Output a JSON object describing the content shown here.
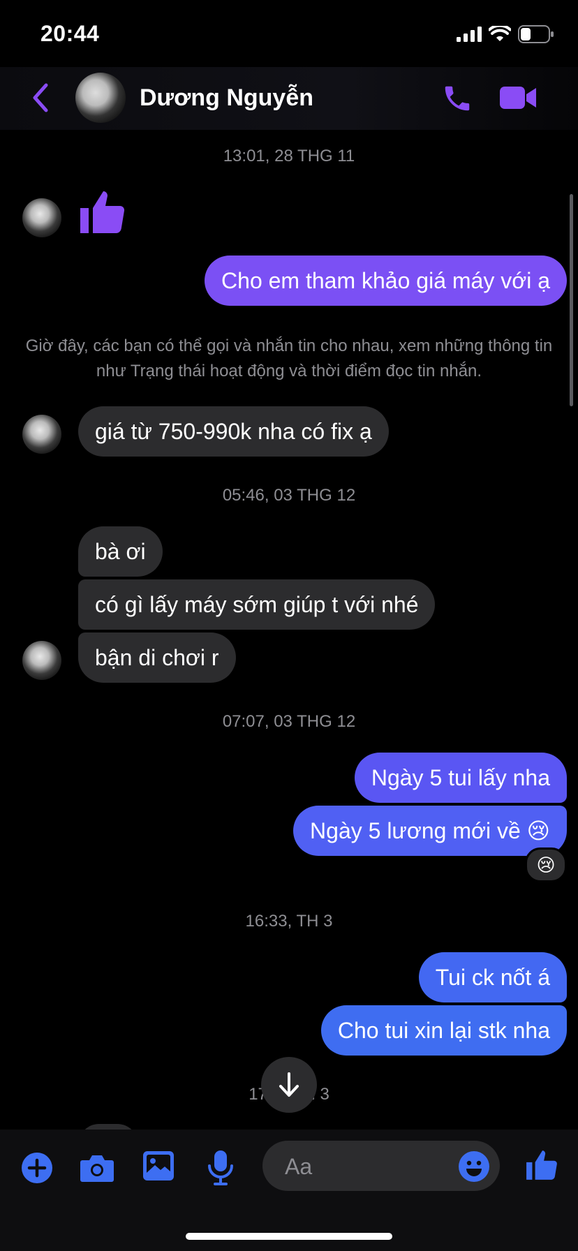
{
  "status_bar": {
    "time": "20:44"
  },
  "header": {
    "contact_name": "Dương Nguyễn"
  },
  "messages": {
    "ts1": "13:01, 28 THG 11",
    "out1": "Cho em tham khảo giá máy với ạ",
    "notice": "Giờ đây, các bạn có thể gọi và nhắn tin cho nhau, xem những thông tin như Trạng thái hoạt động và thời điểm đọc tin nhắn.",
    "in1": "giá từ 750-990k nha có fix ạ",
    "ts2": "05:46, 03 THG 12",
    "in2": "bà ơi",
    "in3": "có gì lấy máy sớm giúp t với nhé",
    "in4": "bận di chơi r",
    "ts3": "07:07, 03 THG 12",
    "out2": "Ngày 5 tui lấy nha",
    "out3": "Ngày 5 lương mới về 😢",
    "reaction": "😢",
    "ts4": "16:33, TH 3",
    "out4": "Tui ck nốt á",
    "out5": "Cho tui xin lại stk nha",
    "ts5": "17:… TH 3"
  },
  "composer": {
    "placeholder": "Aa"
  },
  "colors": {
    "accent_purple": "#8a4cf5",
    "accent_blue": "#3d6ef2",
    "bubble_in": "#2c2c2e",
    "out_purple": "#7b50f4",
    "out_indigo": "#5a56f3",
    "out_blue": "#3f6df1"
  },
  "icons": [
    "back-icon",
    "phone-icon",
    "video-icon",
    "thumbs-up-icon",
    "plus-icon",
    "camera-icon",
    "image-icon",
    "mic-icon",
    "smile-icon",
    "like-icon",
    "arrow-down-icon"
  ]
}
